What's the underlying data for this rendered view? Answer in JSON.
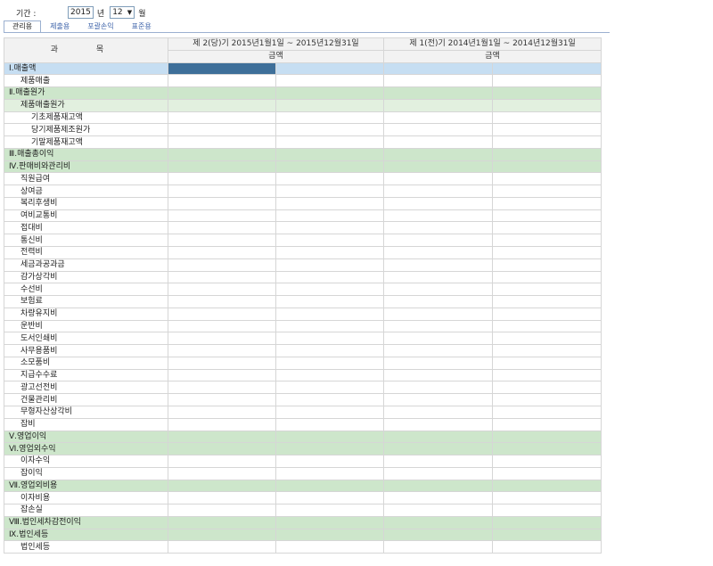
{
  "filter": {
    "period_label": "기간 :",
    "year": "2015",
    "year_unit": "년",
    "month": "12",
    "month_unit": "월"
  },
  "tabs": [
    {
      "label": "관리용",
      "active": true
    },
    {
      "label": "제출용",
      "active": false
    },
    {
      "label": "포괄손익",
      "active": false
    },
    {
      "label": "표준용",
      "active": false
    }
  ],
  "table": {
    "subject_header": "과 목",
    "current_period_header": "제 2(당)기 2015년1월1일 ~ 2015년12월31일",
    "prior_period_header": "제 1(전)기 2014년1월1일 ~ 2014년12월31일",
    "amount_label": "금액",
    "rows": [
      {
        "label": "Ⅰ.매출액",
        "style": "blue",
        "indent": 1
      },
      {
        "label": "제품매출",
        "style": "",
        "indent": 2
      },
      {
        "label": "Ⅱ.매출원가",
        "style": "green",
        "indent": 1
      },
      {
        "label": "제품매출원가",
        "style": "lgreen",
        "indent": 2
      },
      {
        "label": "기초제품재고액",
        "style": "",
        "indent": 3
      },
      {
        "label": "당기제품제조원가",
        "style": "",
        "indent": 3
      },
      {
        "label": "기말제품재고액",
        "style": "",
        "indent": 3
      },
      {
        "label": "Ⅲ.매출총이익",
        "style": "green",
        "indent": 1
      },
      {
        "label": "Ⅳ.판매비와관리비",
        "style": "green",
        "indent": 1
      },
      {
        "label": "직원급여",
        "style": "",
        "indent": 2
      },
      {
        "label": "상여금",
        "style": "",
        "indent": 2
      },
      {
        "label": "복리후생비",
        "style": "",
        "indent": 2
      },
      {
        "label": "여비교통비",
        "style": "",
        "indent": 2
      },
      {
        "label": "접대비",
        "style": "",
        "indent": 2
      },
      {
        "label": "통신비",
        "style": "",
        "indent": 2
      },
      {
        "label": "전력비",
        "style": "",
        "indent": 2
      },
      {
        "label": "세금과공과금",
        "style": "",
        "indent": 2
      },
      {
        "label": "감가상각비",
        "style": "",
        "indent": 2
      },
      {
        "label": "수선비",
        "style": "",
        "indent": 2
      },
      {
        "label": "보험료",
        "style": "",
        "indent": 2
      },
      {
        "label": "차량유지비",
        "style": "",
        "indent": 2
      },
      {
        "label": "운반비",
        "style": "",
        "indent": 2
      },
      {
        "label": "도서인쇄비",
        "style": "",
        "indent": 2
      },
      {
        "label": "사무용품비",
        "style": "",
        "indent": 2
      },
      {
        "label": "소모품비",
        "style": "",
        "indent": 2
      },
      {
        "label": "지급수수료",
        "style": "",
        "indent": 2
      },
      {
        "label": "광고선전비",
        "style": "",
        "indent": 2
      },
      {
        "label": "건물관리비",
        "style": "",
        "indent": 2
      },
      {
        "label": "무형자산상각비",
        "style": "",
        "indent": 2
      },
      {
        "label": "잡비",
        "style": "",
        "indent": 2
      },
      {
        "label": "Ⅴ.영업이익",
        "style": "green",
        "indent": 1
      },
      {
        "label": "Ⅵ.영업외수익",
        "style": "green",
        "indent": 1
      },
      {
        "label": "이자수익",
        "style": "",
        "indent": 2
      },
      {
        "label": "잡이익",
        "style": "",
        "indent": 2
      },
      {
        "label": "Ⅶ.영업외비용",
        "style": "green",
        "indent": 1
      },
      {
        "label": "이자비용",
        "style": "",
        "indent": 2
      },
      {
        "label": "잡손실",
        "style": "",
        "indent": 2
      },
      {
        "label": "Ⅷ.법인세차감전이익",
        "style": "green",
        "indent": 1
      },
      {
        "label": "Ⅸ.법인세등",
        "style": "green",
        "indent": 1
      },
      {
        "label": "법인세등",
        "style": "",
        "indent": 2
      }
    ]
  },
  "colors": {
    "header_bg": "#f2f2f2",
    "section_blue": "#c6def2",
    "section_green": "#cde6cb",
    "subsection_green": "#e2f0df",
    "selected_cell": "#3e6f99",
    "tab_text": "#3b61a8"
  }
}
